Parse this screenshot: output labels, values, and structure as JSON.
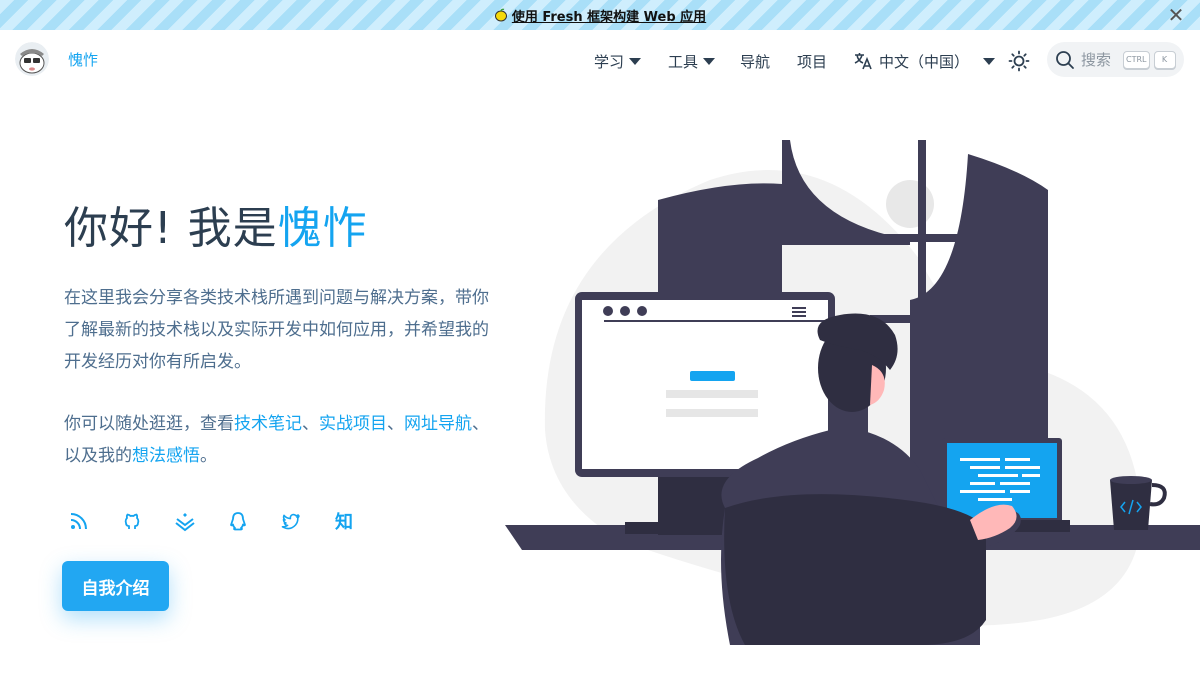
{
  "banner": {
    "text": "使用 Fresh 框架构建 Web 应用",
    "icon": "lemon-icon",
    "close_icon": "close-icon"
  },
  "header": {
    "site_name": "愧怍",
    "avatar": "avatar-icon",
    "nav": {
      "study": "学习",
      "tools": "工具",
      "navigation": "导航",
      "projects": "项目",
      "language": "中文（中国）"
    },
    "theme_icon": "sun-icon",
    "search": {
      "placeholder": "搜索",
      "key_ctrl": "CTRL",
      "key_k": "K"
    }
  },
  "hero": {
    "greeting": "你好! 我是",
    "name": "愧怍",
    "intro": "在这里我会分享各类技术栈所遇到问题与解决方案，带你了解最新的技术栈以及实际开发中如何应用，并希望我的开发经历对你有所启发。",
    "explore_prefix": "你可以随处逛逛，查看",
    "link_notes": "技术笔记",
    "sep1": "、",
    "link_projects": "实战项目",
    "sep2": "、",
    "link_nav": "网址导航",
    "explore_mid": "、以及我的",
    "link_thoughts": "想法感悟",
    "explore_end": "。",
    "cta": "自我介绍"
  },
  "social": {
    "rss": "rss-icon",
    "github": "github-icon",
    "juejin": "juejin-icon",
    "qq": "qq-icon",
    "twitter": "twitter-icon",
    "zhihu": "知"
  },
  "colors": {
    "accent": "#14a4f0",
    "text": "#2c3e50",
    "illustration_dark": "#3f3d56"
  }
}
